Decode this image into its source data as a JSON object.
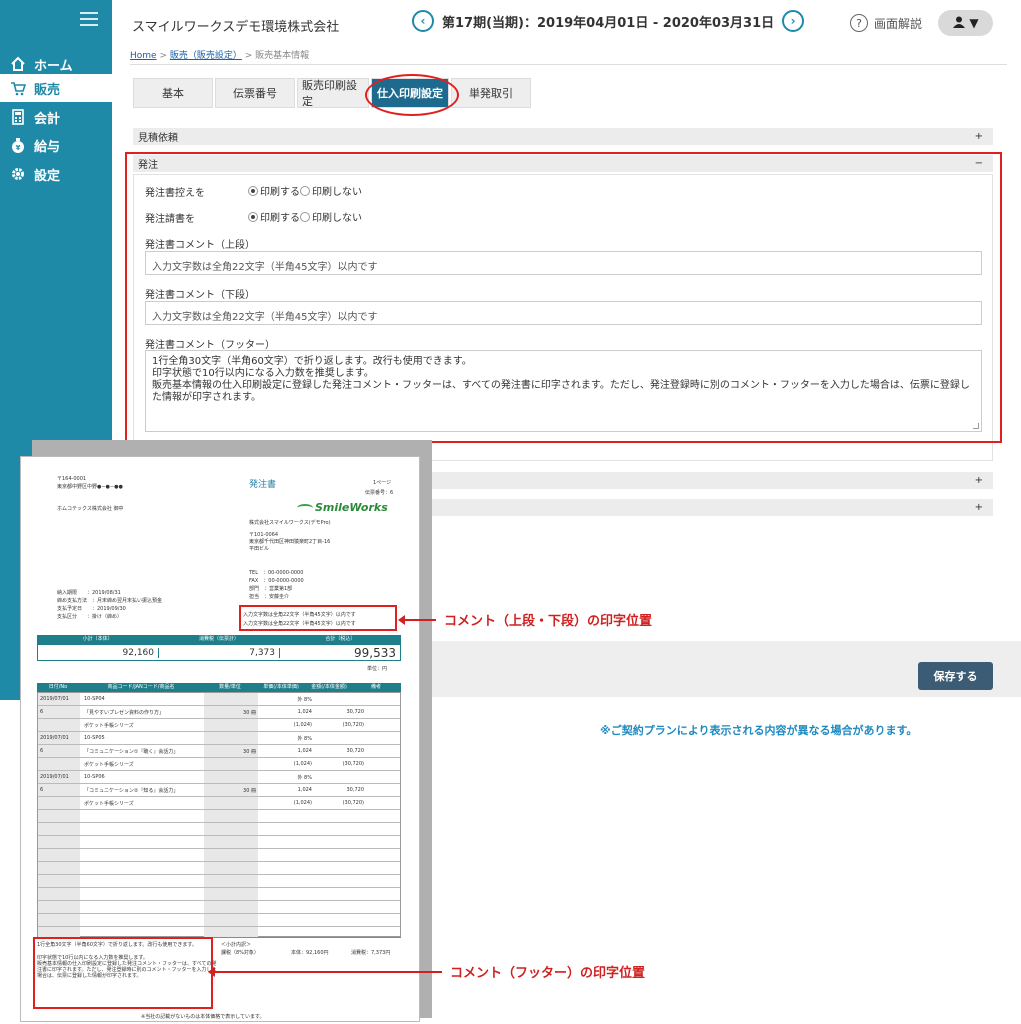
{
  "header": {
    "company": "スマイルワークスデモ環境株式会社",
    "period": "第17期(当期)：2019年04月01日 - 2020年03月31日",
    "help": "画面解説"
  },
  "sidebar": {
    "items": [
      {
        "label": "ホーム",
        "icon": "home-icon"
      },
      {
        "label": "販売",
        "icon": "cart-icon"
      },
      {
        "label": "会計",
        "icon": "calculator-icon"
      },
      {
        "label": "給与",
        "icon": "moneybag-icon"
      },
      {
        "label": "設定",
        "icon": "gear-icon"
      }
    ]
  },
  "breadcrumb": {
    "home": "Home",
    "sep1": " > ",
    "link": "販売（販売設定）",
    "sep2": " > ",
    "current": "販売基本情報"
  },
  "tabs": [
    "基本",
    "伝票番号",
    "販売印刷設定",
    "仕入印刷設定",
    "単発取引"
  ],
  "sections": {
    "estimate": "見積依頼",
    "order": "発注",
    "plus": "+",
    "minus": "−"
  },
  "form": {
    "copy_label": "発注書控えを",
    "request_label": "発注請書を",
    "print_on": "印刷する",
    "print_off": "印刷しない",
    "comment_top_label": "発注書コメント（上段）",
    "comment_top_value": "入力文字数は全角22文字（半角45文字）以内です",
    "comment_bottom_label": "発注書コメント（下段）",
    "comment_bottom_value": "入力文字数は全角22文字（半角45文字）以内です",
    "footer_label": "発注書コメント（フッター）",
    "footer_value": "1行全角30文字（半角60文字）で折り返します。改行も使用できます。\n印字状態で10行以内になる入力数を推奨します。\n販売基本情報の仕入印刷設定に登録した発注コメント・フッターは、すべての発注書に印字されます。ただし、発注登録時に別のコメント・フッターを入力した場合は、伝票に登録した情報が印字されます。"
  },
  "save_label": "保存する",
  "note": "※ご契約プランにより表示される内容が異なる場合があります。",
  "callouts": {
    "top": "コメント（上段・下段）の印字位置",
    "footer": "コメント（フッター）の印字位置"
  },
  "doc": {
    "title": "発注書",
    "page": "1ページ",
    "slip_no": "伝票番号：6",
    "zip_to": "〒164-0001",
    "addr_to": "東京都中野区中野●−●−●●",
    "to_name": "ホムコテックス株式会社 御中",
    "logo": "SmileWorks",
    "company": "株式会社スマイルワークス(デモPro)",
    "zip_from": "〒101-0064",
    "addr_from": "東京都千代田区神田猿楽町2丁目-16",
    "bldg": "平田ビル",
    "tel": "TEL　：00-0000-0000",
    "fax": "FAX　：00-0000-0000",
    "dept": "部門　：営業第1部",
    "person": "担当　：安藤圭介",
    "cmt1": "入力文字数は全角22文字（半角45文字）以内です",
    "cmt2": "入力文字数は全角22文字（半角45文字）以内です",
    "deliv": "納入期限　　：2019/08/31",
    "terms": "締め支払方法　：月末締め翌月末払い振込預金",
    "due": "支払予定日　　：2019/09/30",
    "kind": "支払区分　　：掛け（締め）",
    "totals_h": [
      "小計（本体）",
      "消費税（伝票計）",
      "合計（税込）"
    ],
    "totals_v": [
      "92,160",
      "7,373",
      "99,533"
    ],
    "unit": "単位：円",
    "tbl_h": [
      "日付/No",
      "商品コード/JANコード/商品名",
      "数量/単位",
      "単価(/本体単価)",
      "金額(/本体金額)",
      "備考"
    ],
    "rows": [
      [
        "2019/07/01",
        "10-SP04",
        "",
        "外 8%",
        ""
      ],
      [
        "6",
        "「見やすいプレゼン資料の作り方」",
        "30 冊",
        "1,024",
        "30,720"
      ],
      [
        "",
        "ポケット手帳シリーズ",
        "",
        "(1,024)",
        "(30,720)"
      ],
      [
        "2019/07/01",
        "10-SP05",
        "",
        "外 8%",
        ""
      ],
      [
        "6",
        "「コミュニケーション①『聴く』会話力」",
        "30 冊",
        "1,024",
        "30,720"
      ],
      [
        "",
        "ポケット手帳シリーズ",
        "",
        "(1,024)",
        "(30,720)"
      ],
      [
        "2019/07/01",
        "10-SP06",
        "",
        "外 8%",
        ""
      ],
      [
        "6",
        "「コミュニケーション②『知る』会話力」",
        "30 冊",
        "1,024",
        "30,720"
      ],
      [
        "",
        "ポケット手帳シリーズ",
        "",
        "(1,024)",
        "(30,720)"
      ]
    ],
    "footer1": "1行全角30文字（半角60文字）で折り返します。改行も使用できます。",
    "footer2": "印字状態で10行以内になる入力数を推奨します。",
    "footer3": "販売基本情報の仕入印刷設定に登録した発注コメント・フッターは、すべての発注書に印字されます。ただし、発注登録時に別のコメント・フッターを入力した場合は、伝票に登録した情報が印字されます。",
    "tax_label": "＜小計内訳＞",
    "tax_rate": "課税（8%対象）",
    "tax_base": "本体：92,160円",
    "tax_amt": "消費税：7,373円",
    "bottom": "※当社の記載がないものは本体価格で表示しています。"
  },
  "colors": {
    "accent": "#1e8aa8",
    "highlight": "#e02020",
    "table": "#1e7f8a"
  }
}
